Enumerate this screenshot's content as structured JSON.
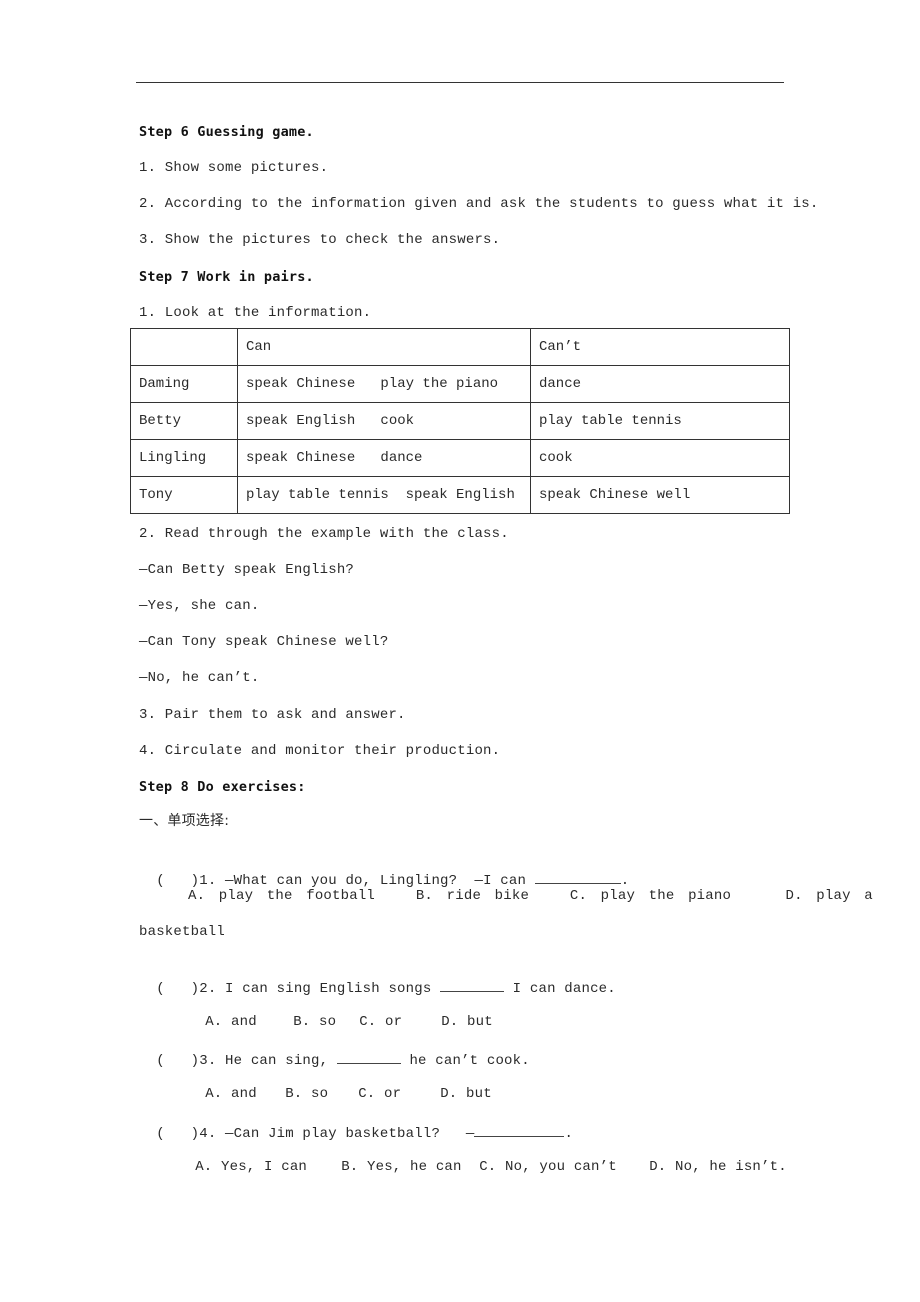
{
  "step6": {
    "heading": "Step 6 Guessing game.",
    "items": [
      "1. Show some pictures.",
      "2. According to the information given and ask the students to guess what it is.",
      "3. Show the pictures to check the answers."
    ]
  },
  "step7": {
    "heading": "Step 7 Work in pairs.",
    "item1": "1. Look at the information.",
    "table": {
      "headers": [
        "",
        "Can",
        "Can’t"
      ],
      "rows": [
        [
          "Daming",
          "speak Chinese   play the piano",
          "dance"
        ],
        [
          "Betty",
          "speak English   cook",
          "play table tennis"
        ],
        [
          "Lingling",
          "speak Chinese   dance",
          "cook"
        ],
        [
          "Tony",
          "play table tennis  speak English",
          "speak Chinese well"
        ]
      ]
    },
    "item2": "2. Read through the example with the class.",
    "dialogue": [
      "—Can Betty speak English?",
      "—Yes, she can.",
      "—Can Tony speak Chinese well?",
      "—No, he can’t."
    ],
    "item3": "3. Pair them to ask and answer.",
    "item4": "4. Circulate and monitor their production."
  },
  "step8": {
    "heading": "Step 8 Do exercises:",
    "section_title": "一、单项选择:",
    "questions": [
      {
        "paren": "(   )",
        "prefix": "1. —What can you do, Lingling?  —I can ",
        "suffix": ".",
        "options_line1": "A. play the football   B. ride bike   C. play the piano    D. play a",
        "options_line2": "basketball"
      },
      {
        "paren": "(   )",
        "prefix": "2. I can sing English songs ",
        "suffix": " I can dance.",
        "options": [
          "A. and",
          "B. so",
          "C. or",
          "D. but"
        ]
      },
      {
        "paren": "(   )",
        "prefix": "3. He can sing, ",
        "suffix": " he can’t cook.",
        "options": [
          "A. and",
          "B. so",
          "C. or",
          "D. but"
        ]
      },
      {
        "paren": "(   )",
        "prefix": "4. —Can Jim play basketball?   —",
        "suffix": ".",
        "options": [
          "A. Yes, I can",
          "B. Yes, he can",
          "C. No, you can’t",
          "D. No, he isn’t."
        ]
      }
    ]
  }
}
